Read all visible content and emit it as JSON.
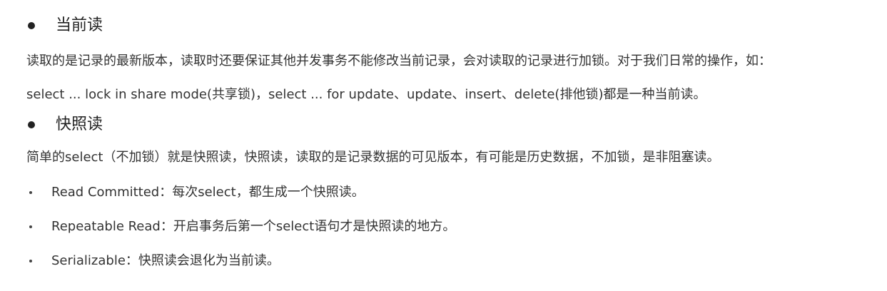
{
  "sections": {
    "current_read": {
      "heading": "当前读",
      "line1": "读取的是记录的最新版本，读取时还要保证其他并发事务不能修改当前记录，会对读取的记录进行加锁。对于我们日常的操作，如：",
      "line2": "select ... lock in share mode(共享锁)，select ... for update、update、insert、delete(排他锁)都是一种当前读。"
    },
    "snapshot_read": {
      "heading": "快照读",
      "line1": "简单的select（不加锁）就是快照读，快照读，读取的是记录数据的可见版本，有可能是历史数据，不加锁，是非阻塞读。",
      "items": [
        "Read Committed：每次select，都生成一个快照读。",
        "Repeatable Read：开启事务后第一个select语句才是快照读的地方。",
        "Serializable：快照读会退化为当前读。"
      ]
    }
  }
}
